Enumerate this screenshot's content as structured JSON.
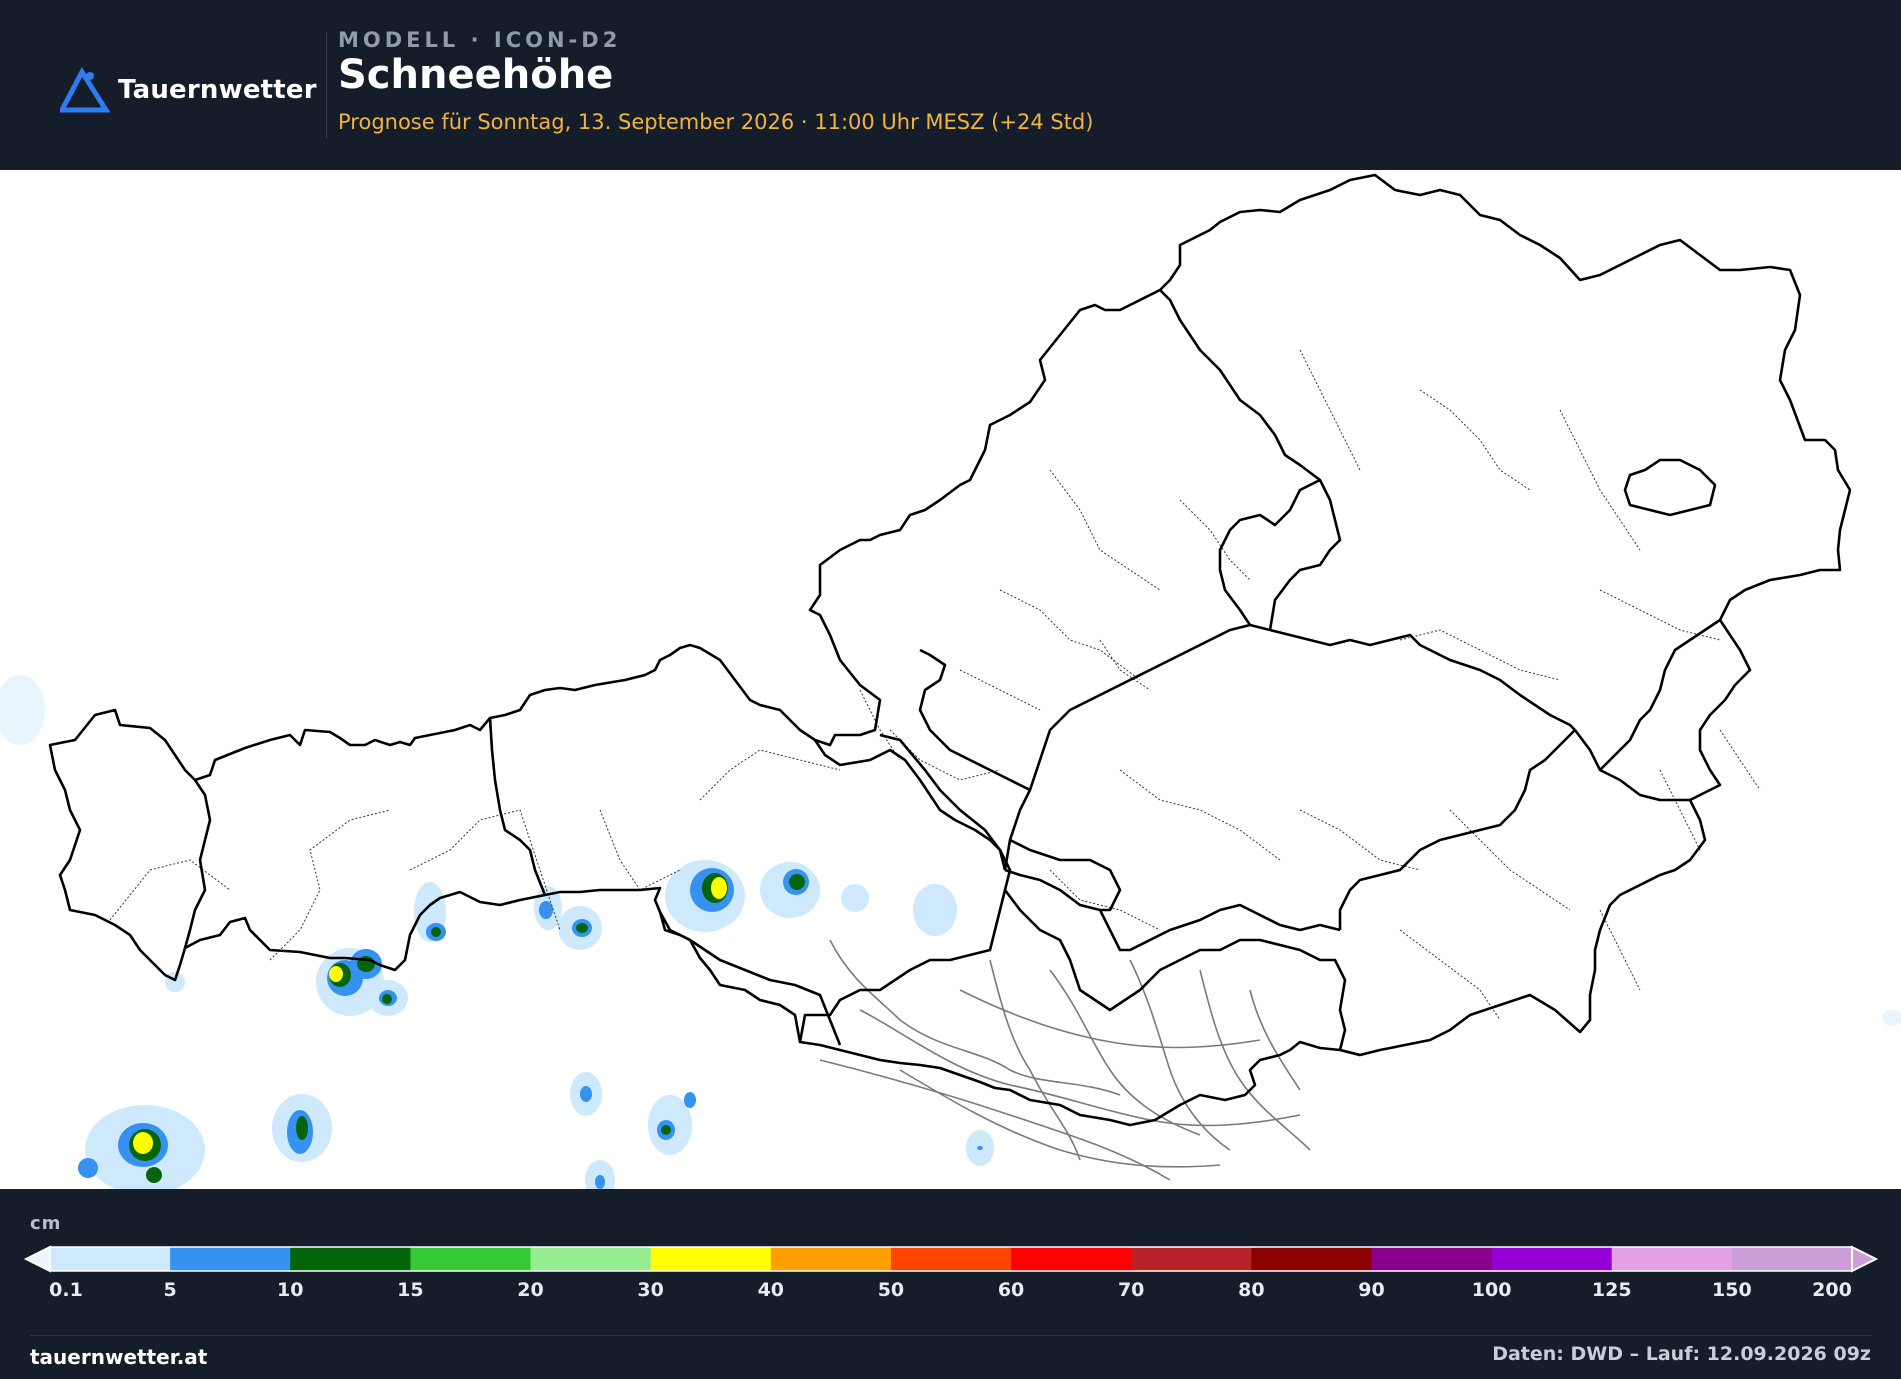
{
  "header": {
    "brand": "Tauernwetter",
    "model_label": "MODELL · ICON-D2",
    "title": "Schneehöhe",
    "forecast_line": "Prognose für Sonntag, 13. September 2026 · 11:00 Uhr MESZ  (+24 Std)"
  },
  "map": {
    "region": "Austria",
    "layers": [
      "state-borders",
      "district-borders",
      "snow-depth-shading"
    ]
  },
  "legend": {
    "unit": "cm",
    "ticks": [
      "0.1",
      "5",
      "10",
      "15",
      "20",
      "30",
      "40",
      "50",
      "60",
      "70",
      "80",
      "90",
      "100",
      "125",
      "150",
      "200"
    ],
    "colors": [
      "#cde9fb",
      "#3791f0",
      "#05650a",
      "#35c935",
      "#96ed8f",
      "#ffff00",
      "#ff9e00",
      "#ff4500",
      "#ff0000",
      "#b8232a",
      "#8b0000",
      "#8a008a",
      "#9400d3",
      "#e4a0e4",
      "#cc9fd8"
    ],
    "under_color": "#e8f5fd",
    "over_color": "#cc9fd8"
  },
  "footer": {
    "site": "tauernwetter.at",
    "source": "Daten: DWD – Lauf: 12.09.2026 09z"
  },
  "colors": {
    "background": "#151d2b",
    "accent_text": "#f2b43c",
    "logo_blue": "#2f7cf0"
  }
}
